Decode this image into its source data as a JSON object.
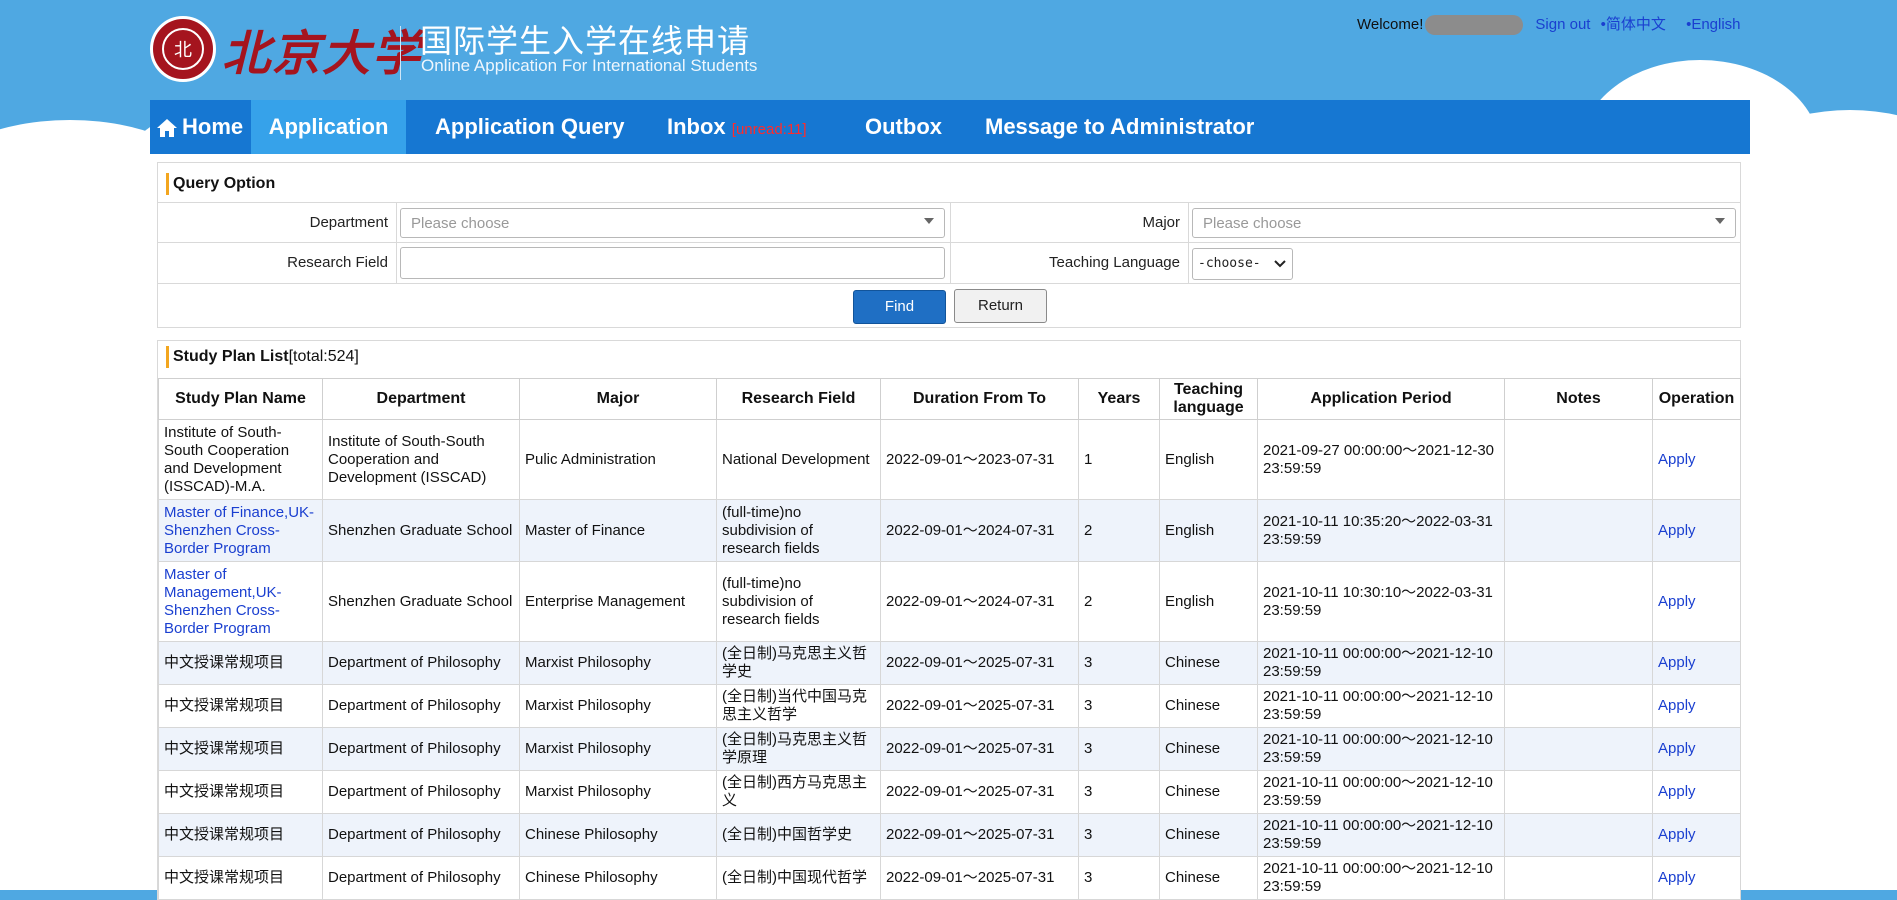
{
  "header": {
    "logo_cn": "北京大学",
    "title_cn": "国际学生入学在线申请",
    "title_en": "Online Application For International Students",
    "welcome": "Welcome!",
    "sign_out": "Sign out",
    "lang_cn": "•简体中文",
    "lang_en": "•English"
  },
  "nav": {
    "home": "Home",
    "application": "Application",
    "query": "Application Query",
    "inbox": "Inbox",
    "inbox_unread": "[unread:11]",
    "outbox": "Outbox",
    "message": "Message to Administrator"
  },
  "query": {
    "title": "Query Option",
    "department_label": "Department",
    "department_placeholder": "Please choose",
    "major_label": "Major",
    "major_placeholder": "Please choose",
    "research_label": "Research Field",
    "research_value": "",
    "language_label": "Teaching Language",
    "language_selected": "-choose-",
    "find": "Find",
    "return": "Return"
  },
  "list": {
    "title": "Study Plan List",
    "total": "[total:524]",
    "columns": [
      "Study Plan Name",
      "Department",
      "Major",
      "Research Field",
      "Duration From To",
      "Years",
      "Teaching language",
      "Application Period",
      "Notes",
      "Operation"
    ],
    "rows": [
      {
        "name": "Institute of South-South Cooperation and Development (ISSCAD)-M.A.",
        "name_link": false,
        "dept": "Institute of South-South Cooperation and Development (ISSCAD)",
        "major": "Pulic Administration",
        "field": "National Development",
        "duration": "2022-09-01～2023-07-31",
        "years": "1",
        "lang": "English",
        "period": "2021-09-27 00:00:00～2021-12-30 23:59:59",
        "notes": "",
        "op": "Apply"
      },
      {
        "name": "Master of Finance,UK-Shenzhen Cross-Border Program",
        "name_link": true,
        "dept": "Shenzhen Graduate School",
        "major": "Master of Finance",
        "field": "(full-time)no subdivision of research fields",
        "duration": "2022-09-01～2024-07-31",
        "years": "2",
        "lang": "English",
        "period": "2021-10-11 10:35:20～2022-03-31 23:59:59",
        "notes": "",
        "op": "Apply"
      },
      {
        "name": "Master of Management,UK-Shenzhen Cross-Border Program",
        "name_link": true,
        "dept": "Shenzhen Graduate School",
        "major": "Enterprise Management",
        "field": "(full-time)no subdivision of research fields",
        "duration": "2022-09-01～2024-07-31",
        "years": "2",
        "lang": "English",
        "period": "2021-10-11 10:30:10～2022-03-31 23:59:59",
        "notes": "",
        "op": "Apply"
      },
      {
        "name": "中文授课常规项目",
        "name_link": false,
        "dept": "Department of Philosophy",
        "major": "Marxist Philosophy",
        "field": "(全日制)马克思主义哲学史",
        "duration": "2022-09-01～2025-07-31",
        "years": "3",
        "lang": "Chinese",
        "period": "2021-10-11 00:00:00～2021-12-10 23:59:59",
        "notes": "",
        "op": "Apply"
      },
      {
        "name": "中文授课常规项目",
        "name_link": false,
        "dept": "Department of Philosophy",
        "major": "Marxist Philosophy",
        "field": "(全日制)当代中国马克思主义哲学",
        "duration": "2022-09-01～2025-07-31",
        "years": "3",
        "lang": "Chinese",
        "period": "2021-10-11 00:00:00～2021-12-10 23:59:59",
        "notes": "",
        "op": "Apply"
      },
      {
        "name": "中文授课常规项目",
        "name_link": false,
        "dept": "Department of Philosophy",
        "major": "Marxist Philosophy",
        "field": "(全日制)马克思主义哲学原理",
        "duration": "2022-09-01～2025-07-31",
        "years": "3",
        "lang": "Chinese",
        "period": "2021-10-11 00:00:00～2021-12-10 23:59:59",
        "notes": "",
        "op": "Apply"
      },
      {
        "name": "中文授课常规项目",
        "name_link": false,
        "dept": "Department of Philosophy",
        "major": "Marxist Philosophy",
        "field": "(全日制)西方马克思主义",
        "duration": "2022-09-01～2025-07-31",
        "years": "3",
        "lang": "Chinese",
        "period": "2021-10-11 00:00:00～2021-12-10 23:59:59",
        "notes": "",
        "op": "Apply"
      },
      {
        "name": "中文授课常规项目",
        "name_link": false,
        "dept": "Department of Philosophy",
        "major": "Chinese Philosophy",
        "field": "(全日制)中国哲学史",
        "duration": "2022-09-01～2025-07-31",
        "years": "3",
        "lang": "Chinese",
        "period": "2021-10-11 00:00:00～2021-12-10 23:59:59",
        "notes": "",
        "op": "Apply"
      },
      {
        "name": "中文授课常规项目",
        "name_link": false,
        "dept": "Department of Philosophy",
        "major": "Chinese Philosophy",
        "field": "(全日制)中国现代哲学",
        "duration": "2022-09-01～2025-07-31",
        "years": "3",
        "lang": "Chinese",
        "period": "2021-10-11 00:00:00～2021-12-10 23:59:59",
        "notes": "",
        "op": "Apply"
      }
    ]
  }
}
